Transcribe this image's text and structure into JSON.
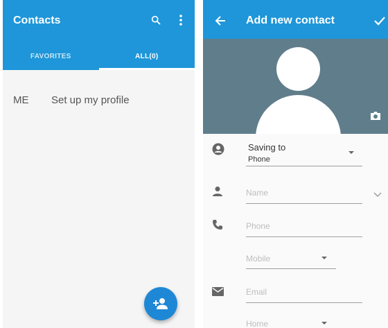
{
  "contacts_screen": {
    "title": "Contacts",
    "tabs": {
      "favorites": "FAVORITES",
      "all": "ALL(0)"
    },
    "profile_row": {
      "badge": "ME",
      "label": "Set up my profile"
    }
  },
  "add_contact_screen": {
    "title": "Add new contact",
    "saving_to": {
      "label": "Saving to",
      "value": "Phone"
    },
    "fields": {
      "name_placeholder": "Name",
      "phone_placeholder": "Phone",
      "phone_type": "Mobile",
      "email_placeholder": "Email",
      "email_type": "Home"
    }
  },
  "colors": {
    "primary": "#1e96d9",
    "fab": "#1e88d6",
    "photo_bg": "#607d8b"
  }
}
